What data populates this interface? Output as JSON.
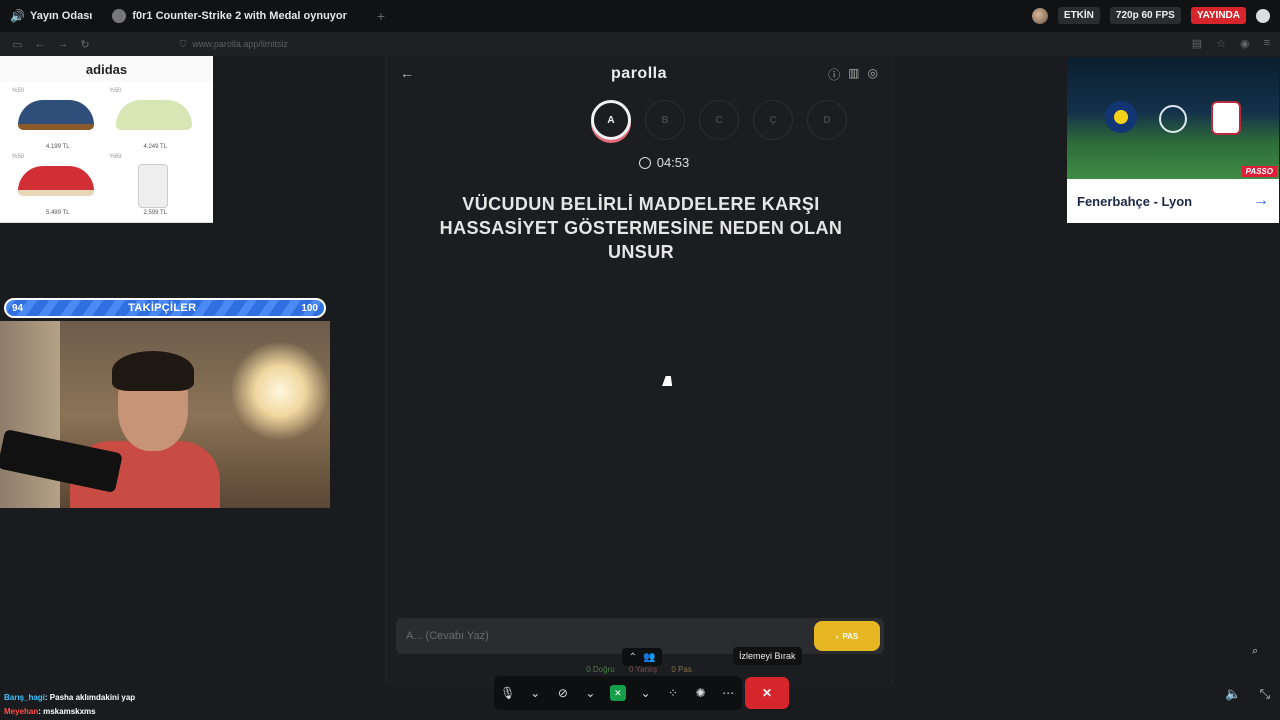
{
  "tabs": [
    {
      "label": "Yayın Odası",
      "icon": "speaker-icon"
    },
    {
      "label": "f0r1 Counter-Strike 2 with Medal oynuyor",
      "icon": "avatar-icon"
    }
  ],
  "status": {
    "active": "ETKİN",
    "quality": "720p 60 FPS",
    "live": "YAYINDA"
  },
  "browser": {
    "url": "www.parolla.app/limitsiz"
  },
  "ad_left": {
    "brand": "adidas",
    "items": [
      {
        "discount": "%50",
        "price": "4.199 TL",
        "color": "#2f4e7a"
      },
      {
        "discount": "%50",
        "price": "4.249 TL",
        "color": "#d7e6b4"
      },
      {
        "discount": "%50",
        "price": "5.499 TL",
        "color": "#d22e36"
      },
      {
        "discount": "%69",
        "price": "2.599 TL",
        "color": "#e8e8e8"
      }
    ]
  },
  "followers": {
    "current": "94",
    "label": "TAKİPÇİLER",
    "goal": "100",
    "fraction": 0.94
  },
  "chat": [
    {
      "user": "Barış_hagi",
      "message": ": Pasha aklımdakini yap"
    },
    {
      "user": "Meyehan",
      "message": ": mskamskxms"
    }
  ],
  "game": {
    "logo": "parolla",
    "letters": [
      "A",
      "B",
      "C",
      "Ç",
      "D"
    ],
    "active_letter": "A",
    "timer": "04:53",
    "question": "VÜCUDUN BELİRLİ MADDELERE KARŞI HASSASİYET GÖSTERMESİNE NEDEN OLAN UNSUR",
    "answer_placeholder": "A... (Cevabı Yaz)",
    "pass_label": "PAS",
    "stats": {
      "correct": "0 Doğru",
      "wrong": "0 Yanlış",
      "pass": "0 Pas"
    }
  },
  "ad_right": {
    "title": "Fenerbahçe - Lyon",
    "sponsor": "PASSO"
  },
  "toolbar": {
    "leave_tooltip": "İzlemeyi Bırak"
  }
}
